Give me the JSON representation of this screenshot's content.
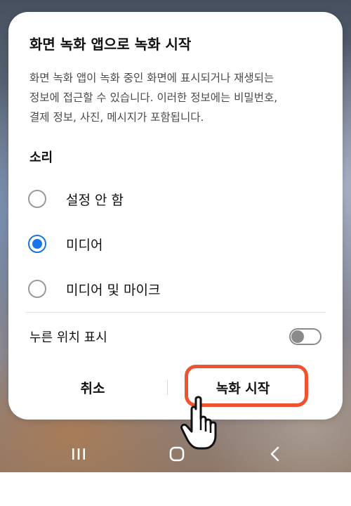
{
  "dialog": {
    "title": "화면 녹화 앱으로 녹화 시작",
    "description_lines": [
      "화면 녹화 앱이 녹화 중인 화면에 표시되거나 재생되는",
      "정보에 접근할 수 있습니다. 이러한 정보에는 비밀번호,",
      "결제 정보, 사진, 메시지가 포함됩니다."
    ],
    "sound_label": "소리",
    "options": [
      {
        "label": "설정 안 함",
        "selected": false
      },
      {
        "label": "미디어",
        "selected": true
      },
      {
        "label": "미디어 및 마이크",
        "selected": false
      }
    ],
    "show_touches_label": "누른 위치 표시",
    "show_touches_enabled": false,
    "cancel_label": "취소",
    "start_label": "녹화 시작"
  },
  "colors": {
    "accent": "#1a73e8",
    "highlight": "#f0522f"
  },
  "nav": {
    "recent_icon": "recent-apps-icon",
    "home_icon": "home-icon",
    "back_icon": "back-icon"
  }
}
